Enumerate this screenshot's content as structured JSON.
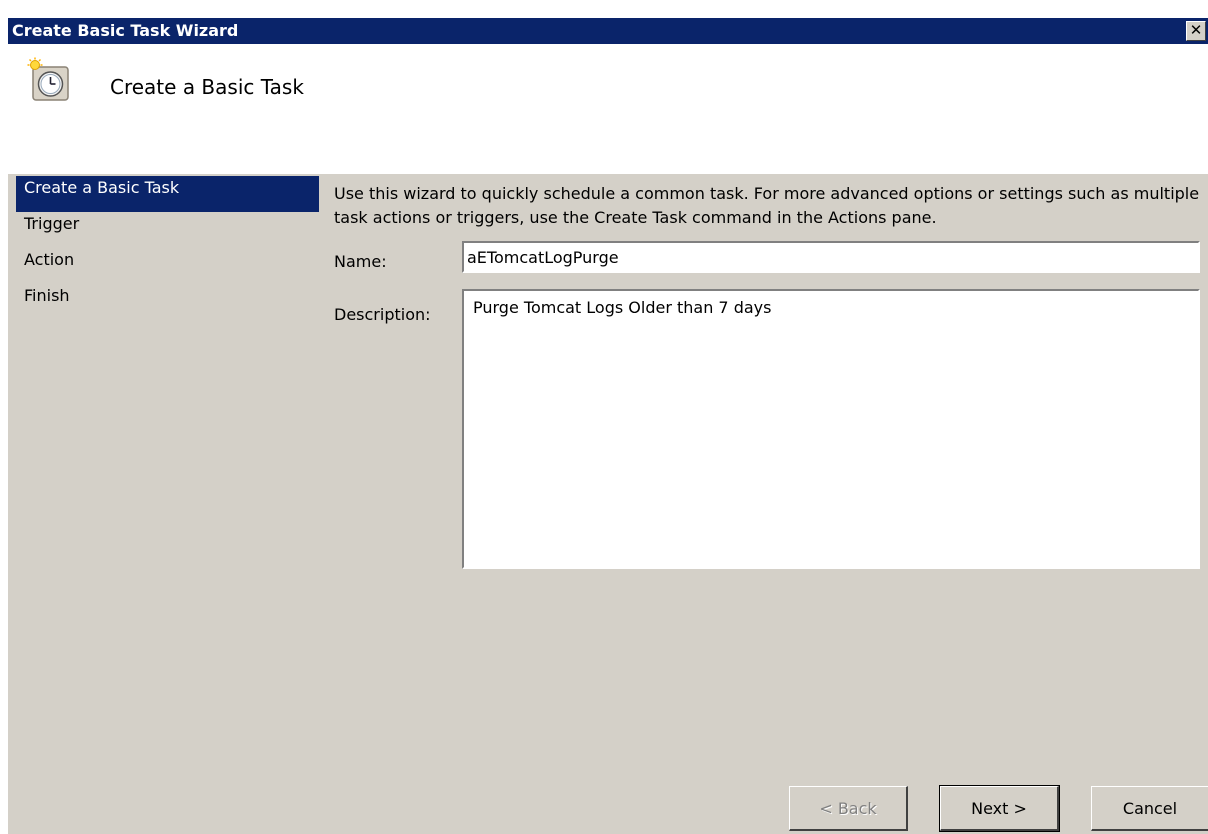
{
  "window": {
    "title": "Create Basic Task Wizard",
    "close_glyph": "✕"
  },
  "header": {
    "icon": "clock-task-icon",
    "title": "Create a Basic Task"
  },
  "steps": [
    {
      "label": "Create a Basic Task",
      "selected": true
    },
    {
      "label": "Trigger",
      "selected": false
    },
    {
      "label": "Action",
      "selected": false
    },
    {
      "label": "Finish",
      "selected": false
    }
  ],
  "intro": "Use this wizard to quickly schedule a common task.  For more advanced options or settings such as multiple task actions or triggers, use the Create Task command in the Actions pane.",
  "form": {
    "name_label": "Name:",
    "name_value": "aETomcatLogPurge",
    "description_label": "Description:",
    "description_value": "Purge Tomcat Logs Older than 7 days"
  },
  "buttons": {
    "back": "< Back",
    "next": "Next >",
    "cancel": "Cancel"
  },
  "colors": {
    "titlebar": "#0a246a",
    "selection": "#0a246a",
    "panel": "#d4d0c8"
  }
}
